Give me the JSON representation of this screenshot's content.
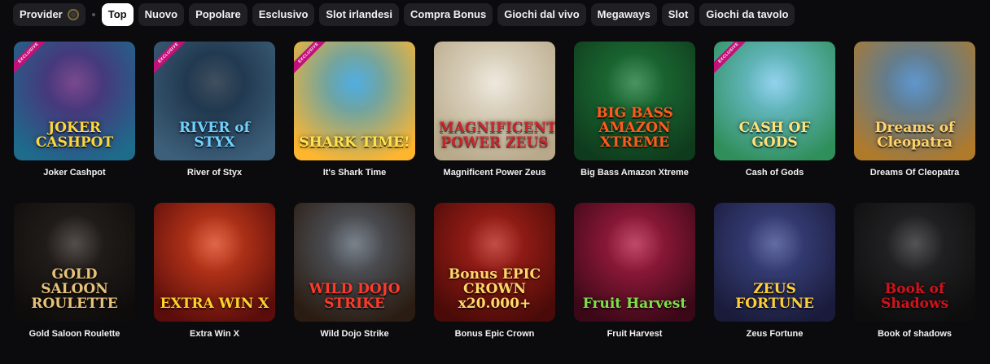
{
  "filters": [
    {
      "label": "Provider",
      "active": false,
      "kind": "provider"
    },
    {
      "label": "Top",
      "active": true
    },
    {
      "label": "Nuovo",
      "active": false
    },
    {
      "label": "Popolare",
      "active": false
    },
    {
      "label": "Esclusivo",
      "active": false
    },
    {
      "label": "Slot irlandesi",
      "active": false
    },
    {
      "label": "Compra Bonus",
      "active": false
    },
    {
      "label": "Giochi dal vivo",
      "active": false
    },
    {
      "label": "Megaways",
      "active": false
    },
    {
      "label": "Slot",
      "active": false
    },
    {
      "label": "Giochi da tavolo",
      "active": false
    }
  ],
  "exclusive_label": "EXCLUSIVE",
  "games": [
    {
      "title": "Joker Cashpot",
      "logo": "JOKER CASHPOT",
      "exclusive": true,
      "bg": "#5a1f73",
      "bg2": "#1e6b8c",
      "logo_color": "#ffd63a"
    },
    {
      "title": "River of Styx",
      "logo": "RIVER of STYX",
      "exclusive": true,
      "bg": "#13263a",
      "bg2": "#3d5f7a",
      "logo_color": "#6fd1ff"
    },
    {
      "title": "It's Shark Time",
      "logo": "SHARK TIME!",
      "exclusive": true,
      "bg": "#2a9bd8",
      "bg2": "#ffb62e",
      "logo_color": "#ffe24a"
    },
    {
      "title": "Magnificent Power Zeus",
      "logo": "MAGNIFICENT POWER ZEUS",
      "exclusive": false,
      "bg": "#e9e3d4",
      "bg2": "#b8a98a",
      "logo_color": "#c9262b"
    },
    {
      "title": "Big Bass Amazon Xtreme",
      "logo": "BIG BASS AMAZON XTREME",
      "exclusive": false,
      "bg": "#1f7a3a",
      "bg2": "#0f3b1d",
      "logo_color": "#ff5a1f"
    },
    {
      "title": "Cash of Gods",
      "logo": "CASH OF GODS",
      "exclusive": true,
      "bg": "#79c7e8",
      "bg2": "#2f8f5a",
      "logo_color": "#ffe27a"
    },
    {
      "title": "Dreams Of Cleopatra",
      "logo": "Dreams of Cleopatra",
      "exclusive": false,
      "bg": "#3b7ec0",
      "bg2": "#b07a2b",
      "logo_color": "#ffd36a"
    },
    {
      "title": "Gold Saloon Roulette",
      "logo": "GOLD SALOON ROULETTE",
      "exclusive": false,
      "bg": "#2a2420",
      "bg2": "#0e0c0b",
      "logo_color": "#e6c27a"
    },
    {
      "title": "Extra Win X",
      "logo": "EXTRA WIN X",
      "exclusive": false,
      "bg": "#d8431d",
      "bg2": "#5a0d0b",
      "logo_color": "#ffd12a"
    },
    {
      "title": "Wild Dojo Strike",
      "logo": "WILD DOJO STRIKE",
      "exclusive": false,
      "bg": "#5a6470",
      "bg2": "#2a1c12",
      "logo_color": "#ff3a2a"
    },
    {
      "title": "Bonus Epic Crown",
      "logo": "Bonus EPIC CROWN x20.000+",
      "exclusive": false,
      "bg": "#b3231b",
      "bg2": "#4a0b08",
      "logo_color": "#ffd86a"
    },
    {
      "title": "Fruit Harvest",
      "logo": "Fruit Harvest",
      "exclusive": false,
      "bg": "#b01f46",
      "bg2": "#3a0817",
      "logo_color": "#7ee04a"
    },
    {
      "title": "Zeus Fortune",
      "logo": "ZEUS FORTUNE",
      "exclusive": false,
      "bg": "#3f4a8c",
      "bg2": "#1a1b3a",
      "logo_color": "#ffcf3a"
    },
    {
      "title": "Book of shadows",
      "logo": "Book of Shadows",
      "exclusive": false,
      "bg": "#2a2a2c",
      "bg2": "#0d0d0e",
      "logo_color": "#d3121b"
    }
  ]
}
